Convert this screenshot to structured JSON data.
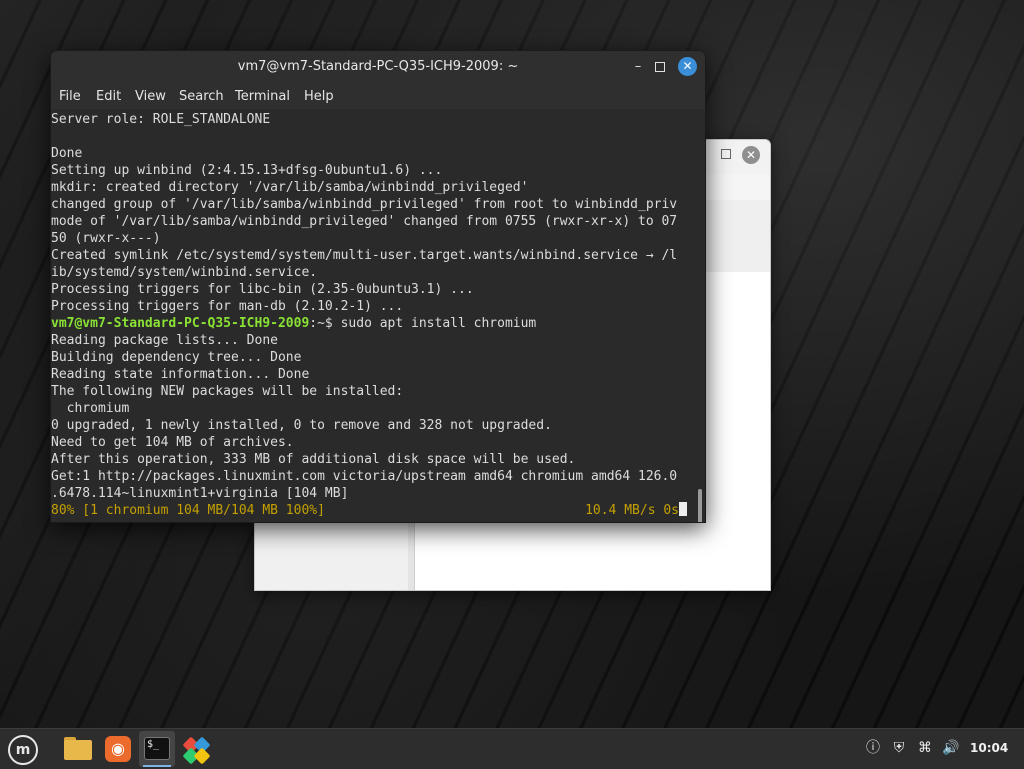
{
  "terminal": {
    "title": "vm7@vm7-Standard-PC-Q35-ICH9-2009: ~",
    "menu": [
      "File",
      "Edit",
      "View",
      "Search",
      "Terminal",
      "Help"
    ],
    "lines": [
      "Server role: ROLE_STANDALONE",
      "",
      "Done",
      "Setting up winbind (2:4.15.13+dfsg-0ubuntu1.6) ...",
      "mkdir: created directory '/var/lib/samba/winbindd_privileged'",
      "changed group of '/var/lib/samba/winbindd_privileged' from root to winbindd_priv",
      "mode of '/var/lib/samba/winbindd_privileged' changed from 0755 (rwxr-xr-x) to 07",
      "50 (rwxr-x---)",
      "Created symlink /etc/systemd/system/multi-user.target.wants/winbind.service → /l",
      "ib/systemd/system/winbind.service.",
      "Processing triggers for libc-bin (2.35-0ubuntu3.1) ...",
      "Processing triggers for man-db (2.10.2-1) ..."
    ],
    "prompt": {
      "user_host": "vm7@vm7-Standard-PC-Q35-ICH9-2009",
      "path": ":~$ ",
      "command": "sudo apt install chromium"
    },
    "output_lines": [
      "Reading package lists... Done",
      "Building dependency tree... Done",
      "Reading state information... Done",
      "The following NEW packages will be installed:",
      "  chromium",
      "0 upgraded, 1 newly installed, 0 to remove and 328 not upgraded.",
      "Need to get 104 MB of archives.",
      "After this operation, 333 MB of additional disk space will be used.",
      "Get:1 http://packages.linuxmint.com victoria/upstream amd64 chromium amd64 126.0",
      ".6478.114~linuxmint1+virginia [104 MB]"
    ],
    "progress": {
      "left": "80% [1 chromium 104 MB/104 MB 100%]",
      "right": "10.4 MB/s 0s"
    }
  },
  "taskbar": {
    "clock": "10:04"
  },
  "colors": {
    "prompt_user": "#8ae234",
    "progress": "#c4a000",
    "close_button": "#3b8fd8"
  },
  "icons": {
    "menu": "mint-menu-icon",
    "files": "folder-icon",
    "app2": "firefox-like-icon",
    "terminal": "terminal-icon",
    "app4": "colorful-app-icon",
    "tray": [
      "notification-icon",
      "shield-icon",
      "network-icon",
      "volume-icon"
    ]
  }
}
